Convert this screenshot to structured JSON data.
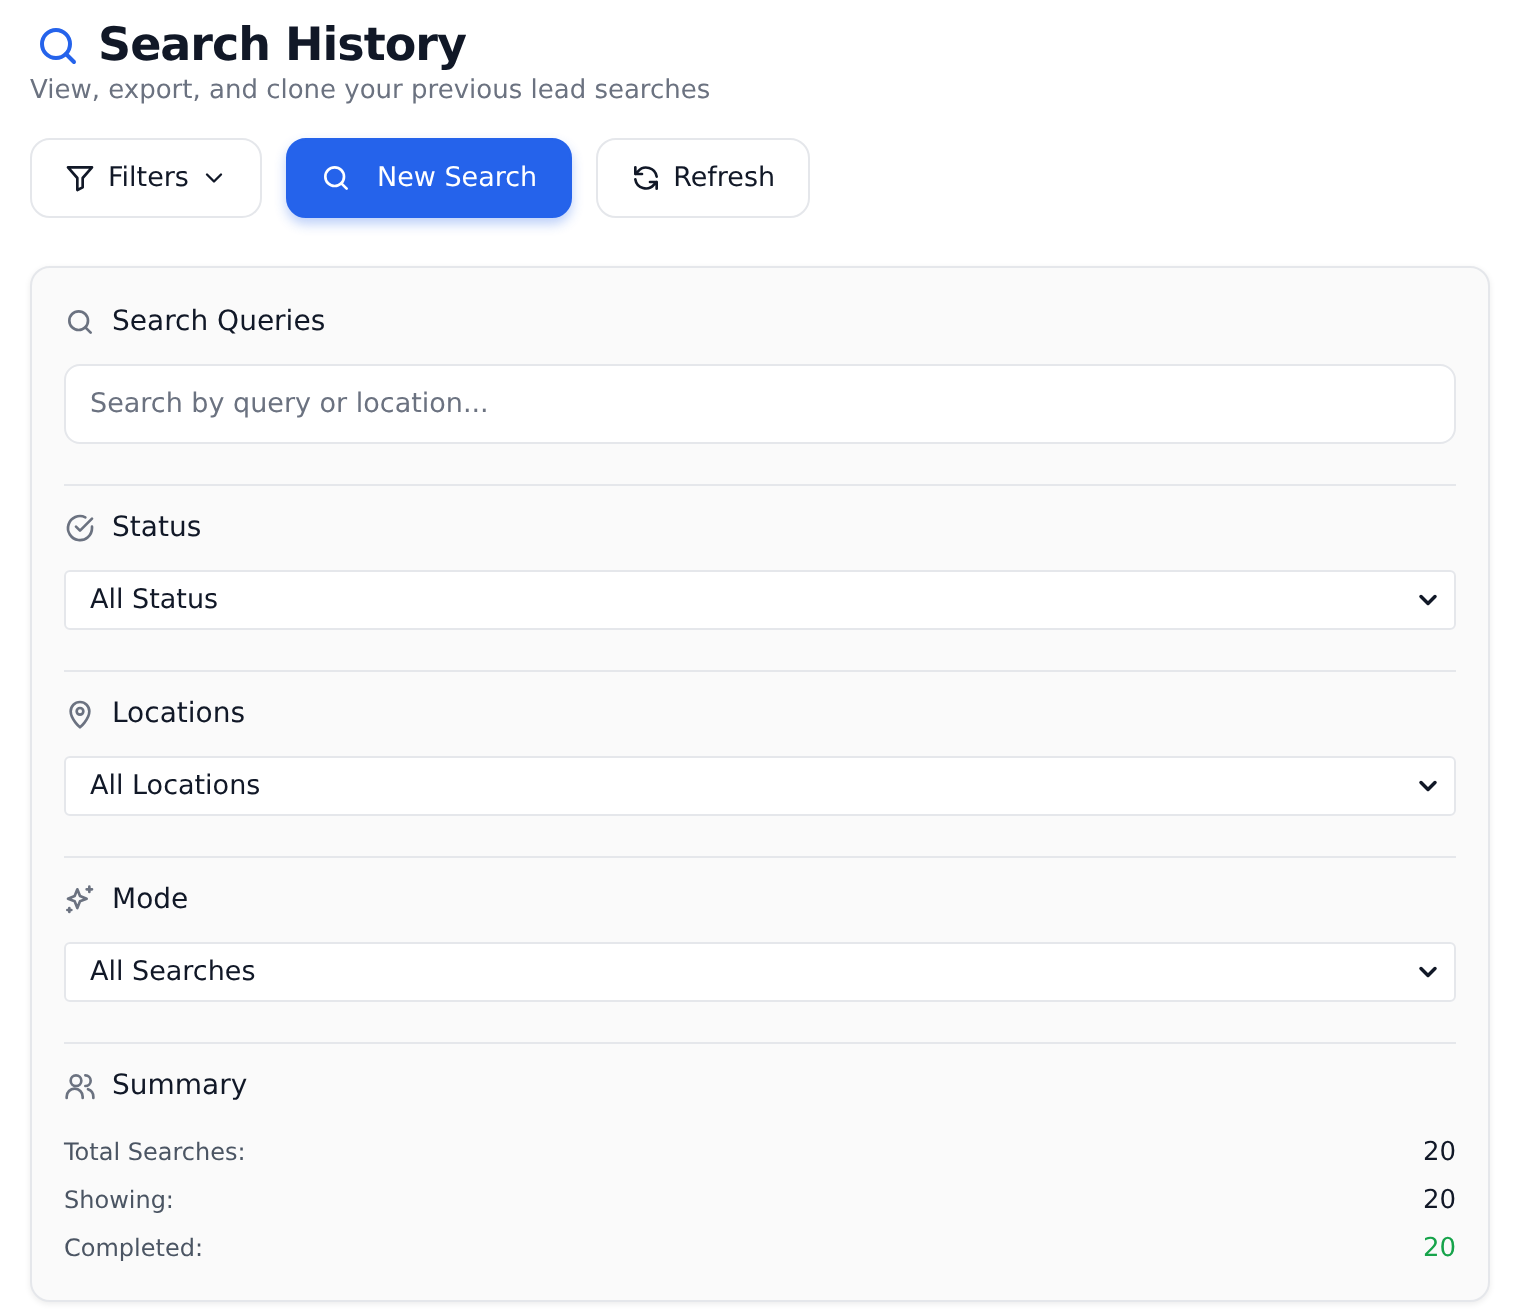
{
  "header": {
    "title": "Search History",
    "subtitle": "View, export, and clone your previous lead searches"
  },
  "buttons": [
    {
      "label": "Filters",
      "primary": false
    },
    {
      "label": "New Search",
      "primary": true
    },
    {
      "label": "Refresh",
      "primary": false
    }
  ],
  "filters": [
    {
      "kind": "search",
      "label": "Search Queries",
      "placeholder": "Search by query or location..."
    },
    {
      "kind": "select",
      "label": "Status",
      "value": "All Status"
    },
    {
      "kind": "select",
      "label": "Locations",
      "value": "All Locations"
    },
    {
      "kind": "select",
      "label": "Mode",
      "value": "All Searches"
    }
  ],
  "summary": {
    "label": "Summary",
    "rows": [
      {
        "label": "Total Searches:",
        "value": "20",
        "color": "#111827"
      },
      {
        "label": "Showing:",
        "value": "20",
        "color": "#111827"
      },
      {
        "label": "Completed:",
        "value": "20",
        "color": "#16a34a"
      }
    ]
  }
}
